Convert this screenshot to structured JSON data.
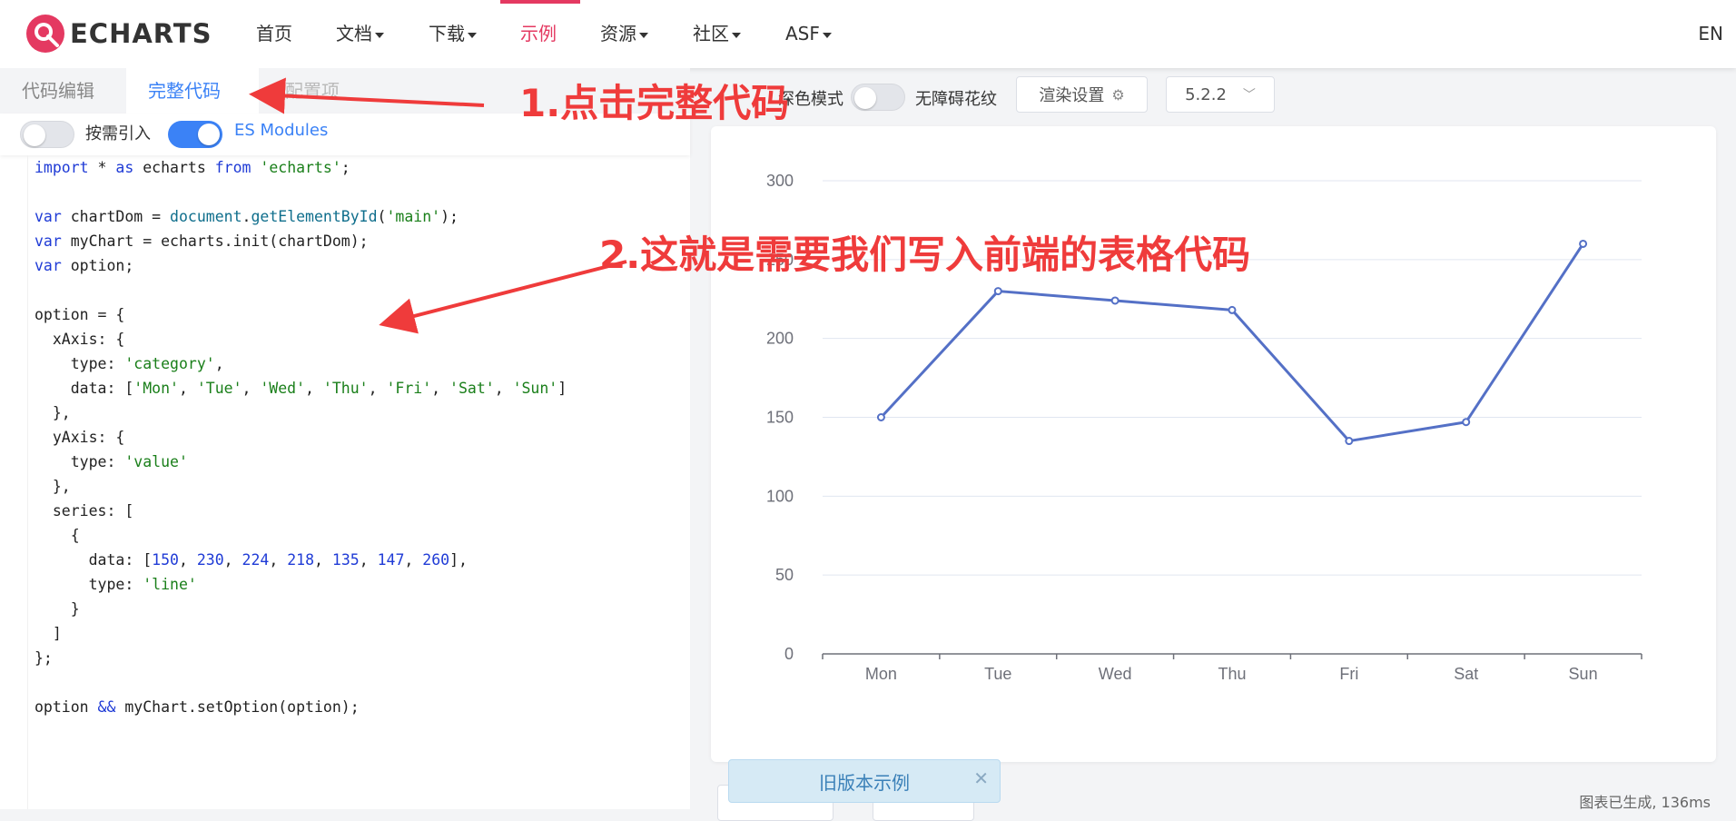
{
  "nav": {
    "logo_text": "ECHARTS",
    "items": [
      {
        "label": "首页",
        "has_caret": false
      },
      {
        "label": "文档",
        "has_caret": true
      },
      {
        "label": "下载",
        "has_caret": true
      },
      {
        "label": "示例",
        "has_caret": false,
        "active": true
      },
      {
        "label": "资源",
        "has_caret": true
      },
      {
        "label": "社区",
        "has_caret": true
      },
      {
        "label": "ASF",
        "has_caret": true
      }
    ],
    "lang": "EN"
  },
  "editor": {
    "tabs": [
      "代码编辑",
      "完整代码",
      "配置项"
    ],
    "active_tab": "完整代码",
    "options": {
      "on_demand_label": "按需引入",
      "on_demand_enabled": false,
      "es_modules_label": "ES Modules",
      "es_modules_enabled": true
    },
    "code_lines": [
      "import * as echarts from 'echarts';",
      "",
      "var chartDom = document.getElementById('main');",
      "var myChart = echarts.init(chartDom);",
      "var option;",
      "",
      "option = {",
      "  xAxis: {",
      "    type: 'category',",
      "    data: ['Mon', 'Tue', 'Wed', 'Thu', 'Fri', 'Sat', 'Sun']",
      "  },",
      "  yAxis: {",
      "    type: 'value'",
      "  },",
      "  series: [",
      "    {",
      "      data: [150, 230, 224, 218, 135, 147, 260],",
      "      type: 'line'",
      "    }",
      "  ]",
      "};",
      "",
      "option && myChart.setOption(option);"
    ]
  },
  "controls": {
    "dark_mode_label": "深色模式",
    "dark_mode_enabled": false,
    "aria_label": "无障碍花纹",
    "render_settings_label": "渲染设置",
    "version": "5.2.2"
  },
  "chart_data": {
    "type": "line",
    "categories": [
      "Mon",
      "Tue",
      "Wed",
      "Thu",
      "Fri",
      "Sat",
      "Sun"
    ],
    "values": [
      150,
      230,
      224,
      218,
      135,
      147,
      260
    ],
    "ylim": [
      0,
      300
    ],
    "yticks": [
      0,
      50,
      100,
      150,
      200,
      250,
      300
    ],
    "grid": true,
    "color": "#5470c6"
  },
  "footer": {
    "old_example_label": "旧版本示例",
    "old_example_close": "✕",
    "status_text": "图表已生成, 136ms"
  },
  "annotations": {
    "step1": "1.点击完整代码",
    "step2": "2.这就是需要我们写入前端的表格代码",
    "color": "#ef3b3b"
  }
}
